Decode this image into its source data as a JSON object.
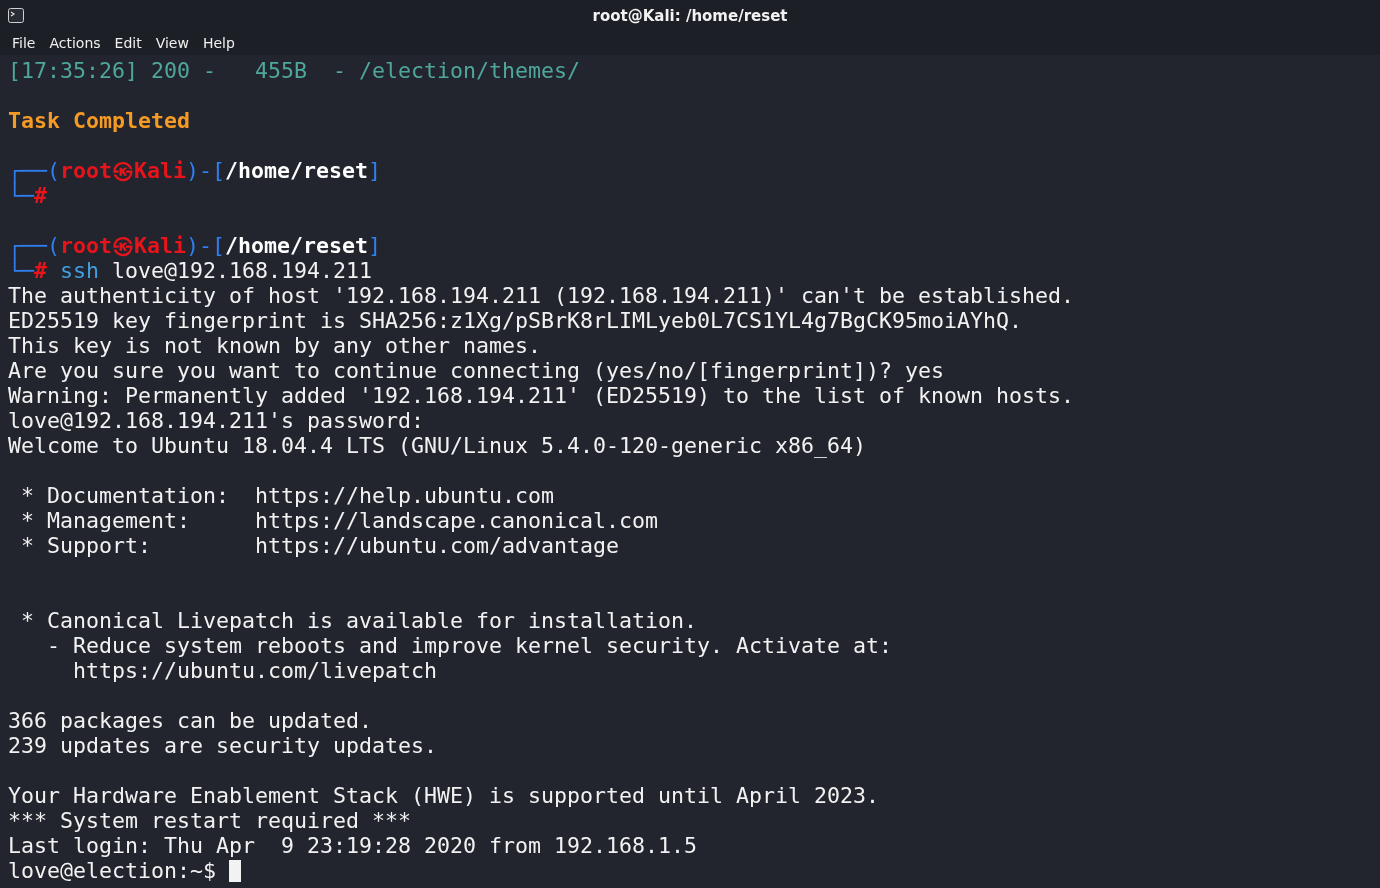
{
  "window": {
    "title": "root@Kali: /home/reset"
  },
  "menu": [
    "File",
    "Actions",
    "Edit",
    "View",
    "Help"
  ],
  "terminal": {
    "cursor_visible": true,
    "lines": [
      {
        "kind": "text",
        "segments": [
          {
            "kind": "status",
            "text": "[17:35:26] 200 -   455B  - /election/themes/"
          }
        ]
      },
      {
        "kind": "blank"
      },
      {
        "kind": "text",
        "segments": [
          {
            "kind": "heading",
            "text": "Task Completed"
          }
        ]
      },
      {
        "kind": "blank"
      },
      {
        "kind": "text",
        "segments": [
          {
            "kind": "frame",
            "text": "┌──("
          },
          {
            "kind": "user",
            "text": "root㉿Kali"
          },
          {
            "kind": "frame",
            "text": ")-["
          },
          {
            "kind": "path",
            "text": "/home/reset"
          },
          {
            "kind": "frame",
            "text": "]"
          }
        ]
      },
      {
        "kind": "text",
        "segments": [
          {
            "kind": "frame",
            "text": "└─"
          },
          {
            "kind": "symbol",
            "text": "#"
          }
        ]
      },
      {
        "kind": "blank"
      },
      {
        "kind": "text",
        "segments": [
          {
            "kind": "frame",
            "text": "┌──("
          },
          {
            "kind": "user",
            "text": "root㉿Kali"
          },
          {
            "kind": "frame",
            "text": ")-["
          },
          {
            "kind": "path",
            "text": "/home/reset"
          },
          {
            "kind": "frame",
            "text": "]"
          }
        ]
      },
      {
        "kind": "text",
        "segments": [
          {
            "kind": "frame",
            "text": "└─"
          },
          {
            "kind": "symbol",
            "text": "#"
          },
          {
            "kind": "command",
            "text": " ssh"
          },
          {
            "kind": "argument",
            "text": " love@192.168.194.211"
          }
        ]
      },
      {
        "kind": "text",
        "segments": [
          {
            "kind": "output",
            "text": "The authenticity of host '192.168.194.211 (192.168.194.211)' can't be established."
          }
        ]
      },
      {
        "kind": "text",
        "segments": [
          {
            "kind": "output",
            "text": "ED25519 key fingerprint is SHA256:z1Xg/pSBrK8rLIMLyeb0L7CS1YL4g7BgCK95moiAYhQ."
          }
        ]
      },
      {
        "kind": "text",
        "segments": [
          {
            "kind": "output",
            "text": "This key is not known by any other names."
          }
        ]
      },
      {
        "kind": "text",
        "segments": [
          {
            "kind": "output",
            "text": "Are you sure you want to continue connecting (yes/no/[fingerprint])? yes"
          }
        ]
      },
      {
        "kind": "text",
        "segments": [
          {
            "kind": "output",
            "text": "Warning: Permanently added '192.168.194.211' (ED25519) to the list of known hosts."
          }
        ]
      },
      {
        "kind": "text",
        "segments": [
          {
            "kind": "output",
            "text": "love@192.168.194.211's password:"
          }
        ]
      },
      {
        "kind": "text",
        "segments": [
          {
            "kind": "output",
            "text": "Welcome to Ubuntu 18.04.4 LTS (GNU/Linux 5.4.0-120-generic x86_64)"
          }
        ]
      },
      {
        "kind": "blank"
      },
      {
        "kind": "text",
        "segments": [
          {
            "kind": "output",
            "text": " * Documentation:  https://help.ubuntu.com"
          }
        ]
      },
      {
        "kind": "text",
        "segments": [
          {
            "kind": "output",
            "text": " * Management:     https://landscape.canonical.com"
          }
        ]
      },
      {
        "kind": "text",
        "segments": [
          {
            "kind": "output",
            "text": " * Support:        https://ubuntu.com/advantage"
          }
        ]
      },
      {
        "kind": "blank"
      },
      {
        "kind": "blank"
      },
      {
        "kind": "text",
        "segments": [
          {
            "kind": "output",
            "text": " * Canonical Livepatch is available for installation."
          }
        ]
      },
      {
        "kind": "text",
        "segments": [
          {
            "kind": "output",
            "text": "   - Reduce system reboots and improve kernel security. Activate at:"
          }
        ]
      },
      {
        "kind": "text",
        "segments": [
          {
            "kind": "output",
            "text": "     https://ubuntu.com/livepatch"
          }
        ]
      },
      {
        "kind": "blank"
      },
      {
        "kind": "text",
        "segments": [
          {
            "kind": "output",
            "text": "366 packages can be updated."
          }
        ]
      },
      {
        "kind": "text",
        "segments": [
          {
            "kind": "output",
            "text": "239 updates are security updates."
          }
        ]
      },
      {
        "kind": "blank"
      },
      {
        "kind": "text",
        "segments": [
          {
            "kind": "output",
            "text": "Your Hardware Enablement Stack (HWE) is supported until April 2023."
          }
        ]
      },
      {
        "kind": "text",
        "segments": [
          {
            "kind": "output",
            "text": "*** System restart required ***"
          }
        ]
      },
      {
        "kind": "text",
        "segments": [
          {
            "kind": "output",
            "text": "Last login: Thu Apr  9 23:19:28 2020 from 192.168.1.5"
          }
        ]
      },
      {
        "kind": "text",
        "segments": [
          {
            "kind": "output",
            "text": "love@election:~$ "
          }
        ]
      }
    ]
  }
}
